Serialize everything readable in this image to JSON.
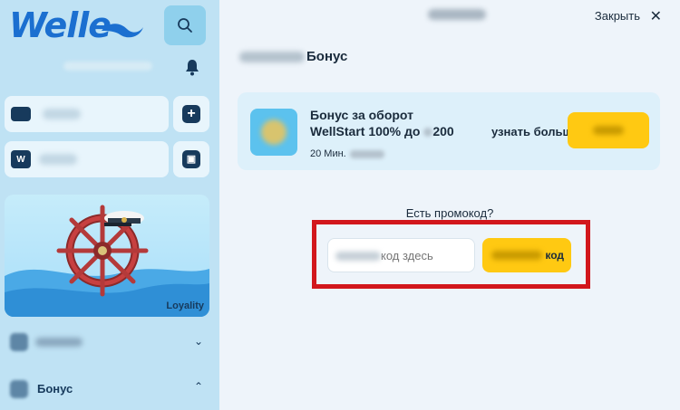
{
  "app": {
    "logo_text": "Welle"
  },
  "sidebar": {
    "loyalty_label": "Loyality",
    "menu": [
      {
        "label": "",
        "expanded": false,
        "chevron": "chevron-down-icon"
      },
      {
        "label": "Бонус",
        "expanded": true,
        "chevron": "chevron-up-icon"
      }
    ]
  },
  "header": {
    "close_label": "Закрыть"
  },
  "section": {
    "title_suffix": "Бонус"
  },
  "bonus_card": {
    "title_line1": "Бонус за оборот",
    "title_line2": "WellStart 100% до",
    "amount": "200",
    "meta_prefix": "20 Мин.",
    "learn_more": "узнать больше"
  },
  "promo": {
    "question": "Есть промокод?",
    "placeholder_suffix": "код здесь",
    "button_suffix": "код"
  },
  "colors": {
    "sidebar_bg": "#bfe2f4",
    "accent_yellow": "#ffc912",
    "highlight_red": "#d2171c",
    "brand_blue": "#1b6fd0"
  }
}
